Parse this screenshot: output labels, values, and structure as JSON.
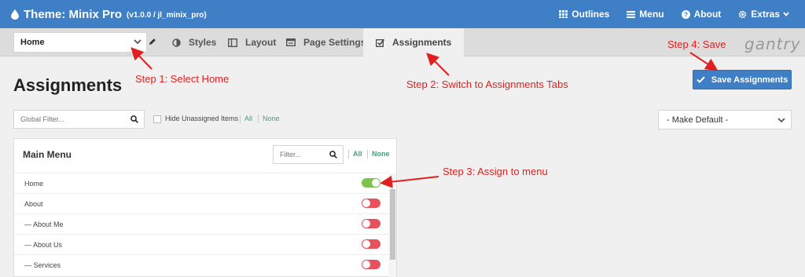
{
  "header": {
    "title": "Theme: Minix Pro",
    "version": "(v1.0.0 / jl_minix_pro)",
    "nav": [
      {
        "label": "Outlines",
        "icon": "grid-icon"
      },
      {
        "label": "Menu",
        "icon": "menu-icon"
      },
      {
        "label": "About",
        "icon": "question-icon"
      },
      {
        "label": "Extras",
        "icon": "gear-icon"
      }
    ],
    "colors": {
      "bar": "#3f7fc5"
    }
  },
  "tabbar": {
    "outline_selected": "Home",
    "tabs": [
      {
        "label": "Styles",
        "icon": "contrast-icon"
      },
      {
        "label": "Layout",
        "icon": "layout-icon"
      },
      {
        "label": "Page Settings",
        "icon": "page-settings-icon"
      },
      {
        "label": "Assignments",
        "icon": "checkbox-icon",
        "active": true
      }
    ],
    "brand_logo": "gantry"
  },
  "page": {
    "title": "Assignments",
    "save_label": "Save Assignments"
  },
  "filters": {
    "global_placeholder": "Global Filter...",
    "hide_unassigned": "Hide Unassigned Items",
    "all": "All",
    "none": "None",
    "default_select": "- Make Default -"
  },
  "menu_card": {
    "title": "Main Menu",
    "filter_placeholder": "Filter...",
    "all": "All",
    "none": "None",
    "items": [
      {
        "label": "Home",
        "on": true
      },
      {
        "label": "About",
        "on": false
      },
      {
        "label": "— About Me",
        "on": false
      },
      {
        "label": "— About Us",
        "on": false
      },
      {
        "label": "— Services",
        "on": false
      }
    ],
    "colors": {
      "on": "#7ec24e",
      "off": "#e8505b"
    }
  },
  "annotations": {
    "step1": "Step 1: Select Home",
    "step2": "Step 2: Switch to Assignments Tabs",
    "step3": "Step 3: Assign to menu",
    "step4": "Step 4: Save",
    "color": "#e02020"
  }
}
